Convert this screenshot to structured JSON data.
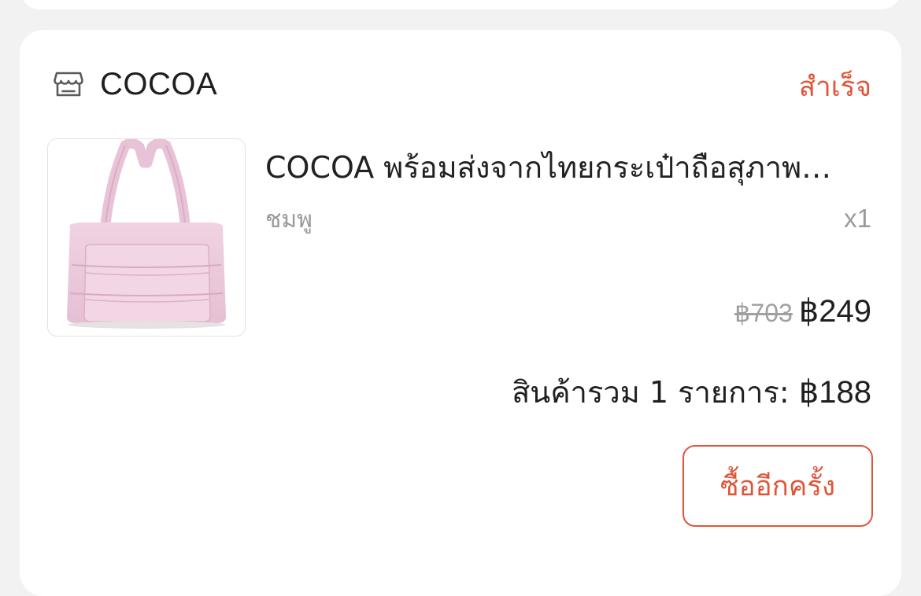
{
  "order": {
    "shop_name": "COCOA",
    "shop_icon": "store-icon",
    "status": "สำเร็จ",
    "product": {
      "title": "COCOA  พร้อมส่งจากไทยกระเป๋าถือสุภาพ…",
      "variant": "ชมพู",
      "quantity": "x1",
      "original_price": "฿703",
      "price": "฿249",
      "image_description": "pink quilted puffer tote bag"
    },
    "total_label": "สินค้ารวม 1 รายการ: ",
    "total_amount": "฿188",
    "buy_again_label": "ซื้ออีกครั้ง"
  },
  "colors": {
    "accent": "#e0553a",
    "background": "#f2f2f2",
    "card": "#ffffff",
    "muted_text": "#9a9a9a",
    "product_pink": "#ecc9dc"
  }
}
